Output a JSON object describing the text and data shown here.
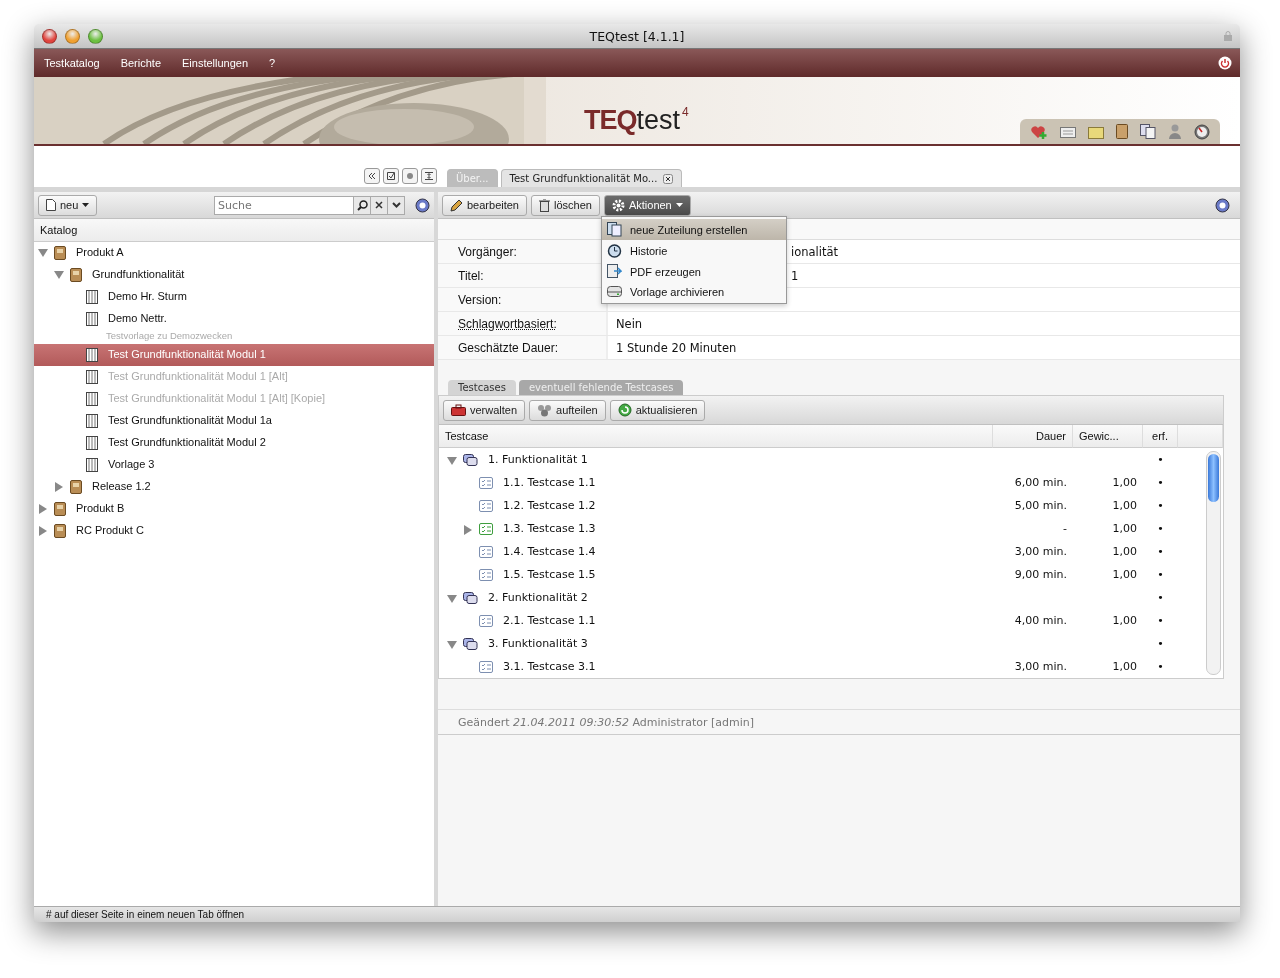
{
  "window": {
    "title": "TEQtest [4.1.1]"
  },
  "menu": [
    "Testkatalog",
    "Berichte",
    "Einstellungen",
    "?"
  ],
  "logo": {
    "brand": "TEQ",
    "name": "test",
    "version": "4"
  },
  "tabs": [
    {
      "label": "Über...",
      "selected": false
    },
    {
      "label": "Test Grundfunktionalität Mo...",
      "selected": true
    }
  ],
  "left_toolbar": {
    "new_button": "neu",
    "search": {
      "placeholder": "Suche"
    }
  },
  "catalog": {
    "header": "Katalog",
    "items": [
      {
        "label": "Produkt A",
        "kind": "folder",
        "expanded": true,
        "selected": false,
        "disabled": false,
        "children": [
          {
            "label": "Grundfunktionalität",
            "kind": "folder",
            "expanded": true,
            "selected": false,
            "disabled": false,
            "children": [
              {
                "label": "Demo Hr. Sturm",
                "kind": "template",
                "selected": false,
                "disabled": false
              },
              {
                "label": "Demo Nettr.",
                "subtitle": "Testvorlage zu Demozwecken",
                "kind": "template",
                "selected": false,
                "disabled": false
              },
              {
                "label": "Test Grundfunktionalität Modul 1",
                "kind": "template",
                "selected": true,
                "disabled": false
              },
              {
                "label": "Test Grundfunktionalität Modul 1 [Alt]",
                "kind": "template",
                "selected": false,
                "disabled": true
              },
              {
                "label": "Test Grundfunktionalität Modul 1 [Alt] [Kopie]",
                "kind": "template",
                "selected": false,
                "disabled": true
              },
              {
                "label": "Test Grundfunktionalität Modul 1a",
                "kind": "template",
                "selected": false,
                "disabled": false
              },
              {
                "label": "Test Grundfunktionalität Modul 2",
                "kind": "template",
                "selected": false,
                "disabled": false
              },
              {
                "label": "Vorlage 3",
                "kind": "template",
                "selected": false,
                "disabled": false
              }
            ]
          },
          {
            "label": "Release 1.2",
            "kind": "folder",
            "expanded": false,
            "selected": false,
            "disabled": false
          }
        ]
      },
      {
        "label": "Produkt B",
        "kind": "folder",
        "expanded": false,
        "selected": false,
        "disabled": false
      },
      {
        "label": "RC Produkt C",
        "kind": "folder",
        "expanded": false,
        "selected": false,
        "disabled": false
      }
    ]
  },
  "actions": {
    "buttons": [
      {
        "label": "bearbeiten",
        "kind": "edit",
        "open": false
      },
      {
        "label": "löschen",
        "kind": "delete",
        "open": false
      },
      {
        "label": "Aktionen",
        "kind": "actions",
        "open": true
      }
    ],
    "menu": [
      {
        "label": "neue Zuteilung erstellen",
        "kind": "assign",
        "selected": true
      },
      {
        "label": "Historie",
        "kind": "history",
        "selected": false
      },
      {
        "label": "PDF erzeugen",
        "kind": "pdf",
        "selected": false
      },
      {
        "label": "Vorlage archivieren",
        "kind": "archive",
        "selected": false
      }
    ]
  },
  "details": [
    {
      "label": "Vorgänger:",
      "value": "ionalität",
      "covered": true,
      "hint": false
    },
    {
      "label": "Titel:",
      "value": "1",
      "covered": true,
      "hint": false
    },
    {
      "label": "Version:",
      "hint": false
    },
    {
      "label": "Schlagwortbasiert:",
      "value": "Nein",
      "hint": true
    },
    {
      "label": "Geschätzte Dauer:",
      "value": "1 Stunde 20 Minuten",
      "hint": false
    }
  ],
  "sub_tabs": [
    {
      "label": "Testcases",
      "selected": true
    },
    {
      "label": "eventuell fehlende Testcases",
      "selected": false
    }
  ],
  "sub_toolbar": [
    {
      "label": "verwalten",
      "kind": "manage"
    },
    {
      "label": "aufteilen",
      "kind": "split"
    },
    {
      "label": "aktualisieren",
      "kind": "refresh"
    }
  ],
  "table": {
    "columns": [
      "Testcase",
      "Dauer",
      "Gewic...",
      "erf."
    ],
    "rows": [
      {
        "label": "1. Funktionalität 1",
        "kind": "group",
        "expanded": true,
        "required": "•",
        "children": [
          {
            "label": "1.1. Testcase 1.1",
            "kind": "testcase",
            "color": "#7d8fb0",
            "duration": "6,00 min.",
            "weight": "1,00",
            "required": "•"
          },
          {
            "label": "1.2. Testcase 1.2",
            "kind": "testcase",
            "color": "#7d8fb0",
            "duration": "5,00 min.",
            "weight": "1,00",
            "required": "•"
          },
          {
            "label": "1.3. Testcase 1.3",
            "kind": "testcase",
            "color": "#3f9e3f",
            "expanded": false,
            "duration": "-",
            "weight": "1,00",
            "required": "•"
          },
          {
            "label": "1.4. Testcase 1.4",
            "kind": "testcase",
            "color": "#7d8fb0",
            "duration": "3,00 min.",
            "weight": "1,00",
            "required": "•"
          },
          {
            "label": "1.5. Testcase 1.5",
            "kind": "testcase",
            "color": "#7d8fb0",
            "duration": "9,00 min.",
            "weight": "1,00",
            "required": "•"
          }
        ]
      },
      {
        "label": "2. Funktionalität 2",
        "kind": "group",
        "expanded": true,
        "required": "•",
        "children": [
          {
            "label": "2.1. Testcase 1.1",
            "kind": "testcase",
            "color": "#7d8fb0",
            "duration": "4,00 min.",
            "weight": "1,00",
            "required": "•"
          }
        ]
      },
      {
        "label": "3. Funktionalität 3",
        "kind": "group",
        "expanded": true,
        "required": "•",
        "children": [
          {
            "label": "3.1. Testcase 3.1",
            "kind": "testcase",
            "color": "#7d8fb0",
            "duration": "3,00 min.",
            "weight": "1,00",
            "required": "•"
          }
        ]
      }
    ]
  },
  "changed": "Geändert *21.04.2011 09:30:52* Administrator [admin]",
  "status_bar": "# auf dieser Seite in einem neuen Tab öffnen"
}
